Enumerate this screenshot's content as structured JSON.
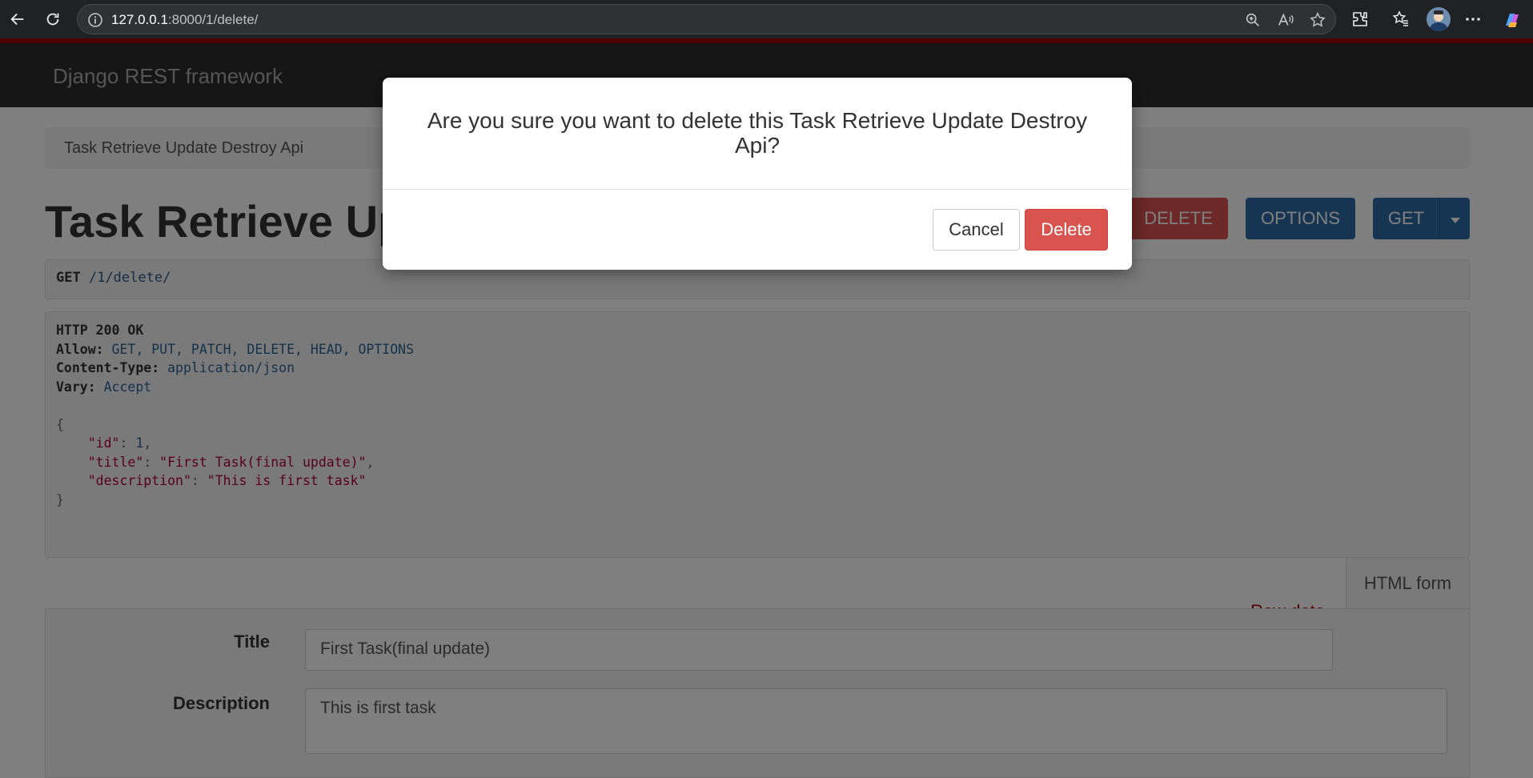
{
  "browser": {
    "url_host": "127.0.0.1",
    "url_rest": ":8000/1/delete/"
  },
  "navbar": {
    "brand": "Django REST framework"
  },
  "breadcrumb": {
    "item": "Task Retrieve Update Destroy Api"
  },
  "page": {
    "title": "Task Retrieve Update Destroy Api"
  },
  "actions": {
    "delete": "DELETE",
    "options": "OPTIONS",
    "get": "GET"
  },
  "request": {
    "method": "GET",
    "path": "/1/delete/"
  },
  "response": {
    "status": "HTTP 200 OK",
    "headers": [
      {
        "name": "Allow:",
        "value": "GET, PUT, PATCH, DELETE, HEAD, OPTIONS"
      },
      {
        "name": "Content-Type:",
        "value": "application/json"
      },
      {
        "name": "Vary:",
        "value": "Accept"
      }
    ],
    "body": {
      "open": "{",
      "close": "}",
      "fields": [
        {
          "key": "\"id\"",
          "value": "1",
          "is_number": true,
          "comma": ","
        },
        {
          "key": "\"title\"",
          "value": "\"First Task(final update)\"",
          "is_number": false,
          "comma": ","
        },
        {
          "key": "\"description\"",
          "value": "\"This is first task\"",
          "is_number": false,
          "comma": ""
        }
      ]
    }
  },
  "tabs": {
    "raw": "Raw data",
    "html": "HTML form"
  },
  "form": {
    "title_label": "Title",
    "title_value": "First Task(final update)",
    "description_label": "Description",
    "description_value": "This is first task"
  },
  "modal": {
    "message": "Are you sure you want to delete this Task Retrieve Update Destroy Api?",
    "cancel": "Cancel",
    "confirm": "Delete"
  },
  "colors": {
    "brand_red": "#a30000",
    "danger": "#d9534f",
    "primary": "#2c6ba7"
  }
}
